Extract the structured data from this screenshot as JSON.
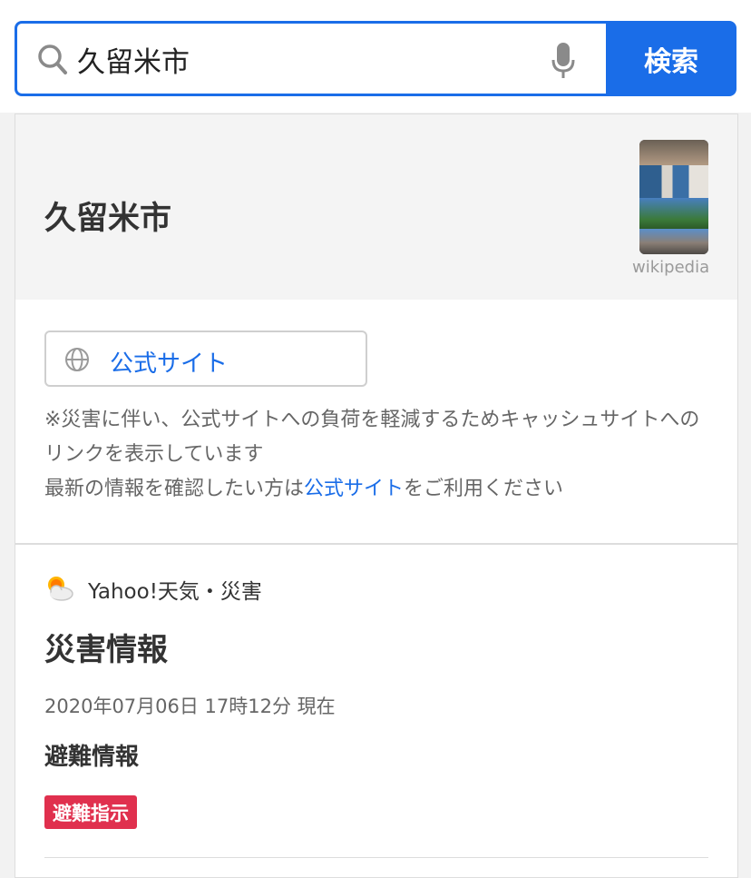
{
  "search": {
    "query": "久留米市",
    "button_label": "検索"
  },
  "entity": {
    "title": "久留米市",
    "image_caption": "wikipedia"
  },
  "official": {
    "button_label": "公式サイト"
  },
  "notice": {
    "line1": "※災害に伴い、公式サイトへの負荷を軽減するためキャッシュサイトへのリンクを表示しています",
    "line2_prefix": "最新の情報を確認したい方は",
    "line2_link": "公式サイト",
    "line2_suffix": "をご利用ください"
  },
  "disaster": {
    "source": "Yahoo!天気・災害",
    "title": "災害情報",
    "timestamp": "2020年07月06日 17時12分 現在",
    "subtitle": "避難情報",
    "badge": "避難指示"
  },
  "colors": {
    "accent": "#1a6de8",
    "badge": "#e0304e"
  },
  "icons": [
    "search-icon",
    "microphone-icon",
    "globe-icon",
    "sun-cloud-icon"
  ]
}
